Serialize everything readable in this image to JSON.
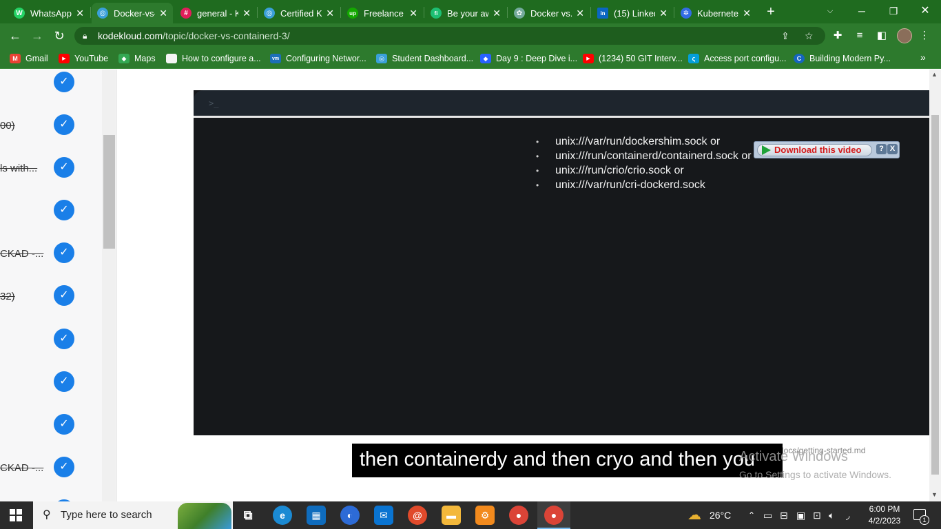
{
  "browser": {
    "tabs": [
      {
        "label": "WhatsApp",
        "icon": "whatsapp-icon",
        "color": "#25d366",
        "glyph": "W"
      },
      {
        "label": "Docker-vs-",
        "icon": "kodekloud-icon",
        "color": "#3aa0d8",
        "glyph": "◎",
        "active": true
      },
      {
        "label": "general - K",
        "icon": "slack-icon",
        "color": "#e01e5a",
        "glyph": "#"
      },
      {
        "label": "Certified K",
        "icon": "kodekloud-icon",
        "color": "#3aa0d8",
        "glyph": "◎"
      },
      {
        "label": "Freelance I",
        "icon": "upwork-icon",
        "color": "#14a800",
        "glyph": "up"
      },
      {
        "label": "Be your aw",
        "icon": "fiverr-icon",
        "color": "#1dbf73",
        "glyph": "fi"
      },
      {
        "label": "Docker vs.",
        "icon": "chatgpt-icon",
        "color": "#74aa9c",
        "glyph": "✿"
      },
      {
        "label": "(15) Linked",
        "icon": "linkedin-icon",
        "color": "#0a66c2",
        "glyph": "in"
      },
      {
        "label": "Kubernete",
        "icon": "kubernetes-icon",
        "color": "#326ce5",
        "glyph": "✲"
      }
    ],
    "new_tab": "+",
    "url_host": "kodekloud.com",
    "url_path": "/topic/docker-vs-containerd-3/",
    "bookmarks": [
      {
        "label": "Gmail",
        "icon": "gmail-icon",
        "color": "#ea4335",
        "glyph": "M"
      },
      {
        "label": "YouTube",
        "icon": "youtube-icon",
        "color": "#ff0000",
        "glyph": "▶"
      },
      {
        "label": "Maps",
        "icon": "maps-icon",
        "color": "#34a853",
        "glyph": "◆"
      },
      {
        "label": "How to configure a...",
        "icon": "bookmark-site-icon",
        "color": "#f4f4f4",
        "glyph": ""
      },
      {
        "label": "Configuring Networ...",
        "icon": "vmware-icon",
        "color": "#1d6fb8",
        "glyph": "vm"
      },
      {
        "label": "Student Dashboard...",
        "icon": "kodekloud-icon",
        "color": "#3aa0d8",
        "glyph": "◎"
      },
      {
        "label": "Day 9 : Deep Dive i...",
        "icon": "hashnode-icon",
        "color": "#2962ff",
        "glyph": "◆"
      },
      {
        "label": "(1234) 50 GIT Interv...",
        "icon": "youtube-icon",
        "color": "#ff0000",
        "glyph": "▶"
      },
      {
        "label": "Access port configu...",
        "icon": "cisco-icon",
        "color": "#049fd9",
        "glyph": "ς"
      },
      {
        "label": "Building Modern Py...",
        "icon": "codemag-icon",
        "color": "#1565c0",
        "glyph": "C"
      }
    ]
  },
  "sidebar": {
    "items": [
      {
        "text": ""
      },
      {
        "text": "00)"
      },
      {
        "text": "ls with..."
      },
      {
        "text": ""
      },
      {
        "text": "CKAD -..."
      },
      {
        "text": "32)"
      },
      {
        "text": ""
      },
      {
        "text": ""
      },
      {
        "text": ""
      },
      {
        "text": "CKAD -..."
      }
    ],
    "check_color": "#1a7fe8"
  },
  "video": {
    "prompt": ">_",
    "socket_list": [
      "unix:///var/run/dockershim.sock or",
      "unix:///run/containerd/containerd.sock or",
      "unix:///run/crio/crio.sock or",
      "unix:///var/run/cri-dockerd.sock"
    ],
    "download_label": "Download this video",
    "download_help": "?",
    "download_close": "X",
    "caption": "then containerdy and then cryo and then you",
    "behind_text": "docs/getting-started.md"
  },
  "watermark": {
    "title": "Activate Windows",
    "subtitle": "Go to Settings to activate Windows."
  },
  "taskbar": {
    "search_placeholder": "Type here to search",
    "temperature": "26°C",
    "time": "6:00 PM",
    "date": "4/2/2023",
    "notification_count": "1"
  }
}
